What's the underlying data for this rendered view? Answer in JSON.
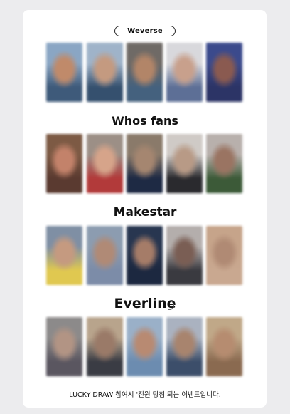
{
  "sections": [
    {
      "title": "Weverse"
    },
    {
      "title": "Whos fans"
    },
    {
      "title": "Makestar"
    },
    {
      "title": "Everline"
    }
  ],
  "footer": {
    "text": "LUCKY DRAW 참여시 '전원 당첨'되는 이벤트입니다."
  },
  "photo_rows": [
    [
      {
        "top": "#8aa6c4",
        "mid": "#c08a6a",
        "bottom": "#3e5a7a"
      },
      {
        "top": "#9fb3c9",
        "mid": "#c49a80",
        "bottom": "#35506e"
      },
      {
        "top": "#6f6a66",
        "mid": "#b28568",
        "bottom": "#44617e"
      },
      {
        "top": "#d8d8dc",
        "mid": "#c8a08c",
        "bottom": "#5d6f96"
      },
      {
        "top": "#3b4a8c",
        "mid": "#8a5a50",
        "bottom": "#2c3466"
      }
    ],
    [
      {
        "top": "#7d5a44",
        "mid": "#c3826a",
        "bottom": "#5a3a30"
      },
      {
        "top": "#9c8f86",
        "mid": "#d6a48a",
        "bottom": "#b23a3a"
      },
      {
        "top": "#8a7a6a",
        "mid": "#a58670",
        "bottom": "#1e2a44"
      },
      {
        "top": "#cfcac6",
        "mid": "#b89a86",
        "bottom": "#2a2a2e"
      },
      {
        "top": "#b8b0ac",
        "mid": "#9a7462",
        "bottom": "#3c5a38"
      }
    ],
    [
      {
        "top": "#7f8fa4",
        "mid": "#c59a80",
        "bottom": "#e0c850"
      },
      {
        "top": "#8c9cb0",
        "mid": "#b08a76",
        "bottom": "#7c8ca8"
      },
      {
        "top": "#283650",
        "mid": "#a57c68",
        "bottom": "#1c2840"
      },
      {
        "top": "#b4aeac",
        "mid": "#7a5e54",
        "bottom": "#3a3a40"
      },
      {
        "top": "#c6a48a",
        "mid": "#b08a74",
        "bottom": "#c9a890"
      }
    ],
    [
      {
        "top": "#8c8a8a",
        "mid": "#b29484",
        "bottom": "#5a5660"
      },
      {
        "top": "#b8a48c",
        "mid": "#9a7a68",
        "bottom": "#3a3c44"
      },
      {
        "top": "#9ab0c8",
        "mid": "#b88a72",
        "bottom": "#6c8cb0"
      },
      {
        "top": "#aab2c0",
        "mid": "#a8846e",
        "bottom": "#3c4e6a"
      },
      {
        "top": "#c0a888",
        "mid": "#b68c70",
        "bottom": "#8a6a50"
      }
    ]
  ]
}
